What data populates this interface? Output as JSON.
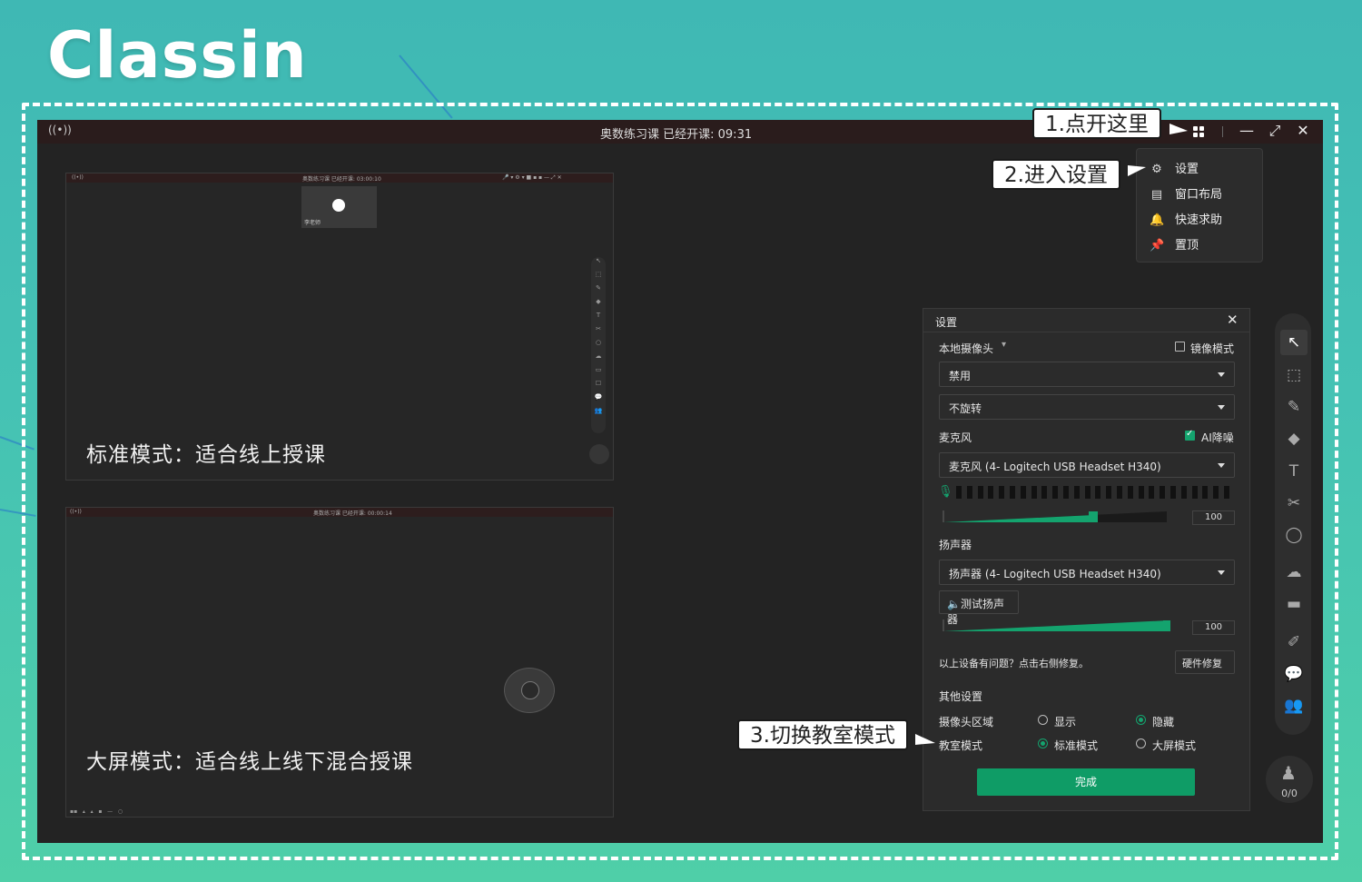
{
  "logo": "Classin",
  "app": {
    "live_icon": "((•))",
    "title": "奥数练习课   已经开课: 09:31",
    "window": {
      "minimize": "—",
      "restore": "⤢",
      "close": "✕"
    }
  },
  "thumbs": {
    "standard": {
      "bar_title": "奥数练习课   已经开课: 03:00:10",
      "teacher": "李老师",
      "caption": "标准模式：适合线上授课",
      "seat_count": "0/0"
    },
    "bigscreen": {
      "bar_title": "奥数练习课   已经开课: 00:00:14",
      "caption": "大屏模式：适合线上线下混合授课"
    }
  },
  "menu": {
    "items": [
      {
        "icon": "gear-icon",
        "glyph": "⚙",
        "label": "设置"
      },
      {
        "icon": "layout-icon",
        "glyph": "▤",
        "label": "窗口布局"
      },
      {
        "icon": "bell-icon",
        "glyph": "🔔",
        "label": "快速求助"
      },
      {
        "icon": "pin-icon",
        "glyph": "📌",
        "label": "置顶"
      }
    ]
  },
  "settings": {
    "title": "设置",
    "camera_label": "本地摄像头",
    "mirror_label": "镜像模式",
    "camera_value": "禁用",
    "rotate_value": "不旋转",
    "mic_label": "麦克风",
    "ai_denoise_label": "AI降噪",
    "mic_value": "麦克风 (4- Logitech USB Headset H340)",
    "mic_volume": "100",
    "speaker_label": "扬声器",
    "speaker_value": "扬声器 (4- Logitech USB Headset H340)",
    "test_speaker": "测试扬声器",
    "speaker_volume": "100",
    "repair_hint": "以上设备有问题？点击右侧修复。",
    "repair_button": "硬件修复",
    "other_label": "其他设置",
    "camera_area_label": "摄像头区域",
    "camera_area_show": "显示",
    "camera_area_hide": "隐藏",
    "classroom_mode_label": "教室模式",
    "mode_standard": "标准模式",
    "mode_bigscreen": "大屏模式",
    "done": "完成"
  },
  "seat_count": "0/0",
  "callouts": {
    "step1": "1.点开这里",
    "step2": "2.进入设置",
    "step3": "3.切换教室模式"
  },
  "colors": {
    "accent": "#0f9c66",
    "bg_teal": "#45c2b4"
  }
}
